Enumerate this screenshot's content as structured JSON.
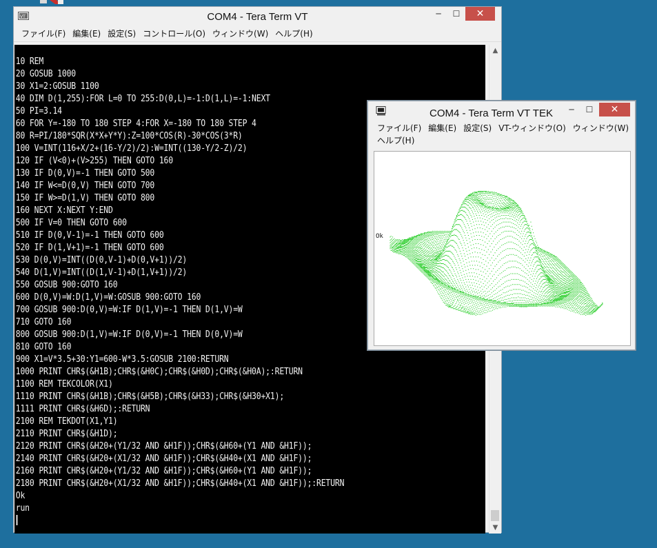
{
  "vt_window": {
    "title": "COM4 - Tera Term VT",
    "menu": [
      {
        "label": "ファイル(F)"
      },
      {
        "label": "編集(E)"
      },
      {
        "label": "設定(S)"
      },
      {
        "label": "コントロール(O)"
      },
      {
        "label": "ウィンドウ(W)"
      },
      {
        "label": "ヘルプ(H)"
      }
    ],
    "terminal_lines": [
      "10 REM",
      "20 GOSUB 1000",
      "30 X1=2:GOSUB 1100",
      "40 DIM D(1,255):FOR L=0 TO 255:D(0,L)=-1:D(1,L)=-1:NEXT",
      "50 PI=3.14",
      "60 FOR Y=-180 TO 180 STEP 4:FOR X=-180 TO 180 STEP 4",
      "80 R=PI/180*SQR(X*X+Y*Y):Z=100*COS(R)-30*COS(3*R)",
      "100 V=INT(116+X/2+(16-Y/2)/2):W=INT((130-Y/2-Z)/2)",
      "120 IF (V<0)+(V>255) THEN GOTO 160",
      "130 IF D(0,V)=-1 THEN GOTO 500",
      "140 IF W<=D(0,V) THEN GOTO 700",
      "150 IF W>=D(1,V) THEN GOTO 800",
      "160 NEXT X:NEXT Y:END",
      "500 IF V=0 THEN GOTO 600",
      "510 IF D(0,V-1)=-1 THEN GOTO 600",
      "520 IF D(1,V+1)=-1 THEN GOTO 600",
      "530 D(0,V)=INT((D(0,V-1)+D(0,V+1))/2)",
      "540 D(1,V)=INT((D(1,V-1)+D(1,V+1))/2)",
      "550 GOSUB 900:GOTO 160",
      "600 D(0,V)=W:D(1,V)=W:GOSUB 900:GOTO 160",
      "700 GOSUB 900:D(0,V)=W:IF D(1,V)=-1 THEN D(1,V)=W",
      "710 GOTO 160",
      "800 GOSUB 900:D(1,V)=W:IF D(0,V)=-1 THEN D(0,V)=W",
      "810 GOTO 160",
      "900 X1=V*3.5+30:Y1=600-W*3.5:GOSUB 2100:RETURN",
      "1000 PRINT CHR$(&H1B);CHR$(&H0C);CHR$(&H0D);CHR$(&H0A);:RETURN",
      "1100 REM TEKCOLOR(X1)",
      "1110 PRINT CHR$(&H1B);CHR$(&H5B);CHR$(&H33);CHR$(&H30+X1);",
      "1111 PRINT CHR$(&H6D);:RETURN",
      "2100 REM TEKDOT(X1,Y1)",
      "2110 PRINT CHR$(&H1D);",
      "2120 PRINT CHR$(&H20+(Y1/32 AND &H1F));CHR$(&H60+(Y1 AND &H1F));",
      "2140 PRINT CHR$(&H20+(X1/32 AND &H1F));CHR$(&H40+(X1 AND &H1F));",
      "2160 PRINT CHR$(&H20+(Y1/32 AND &H1F));CHR$(&H60+(Y1 AND &H1F));",
      "2180 PRINT CHR$(&H20+(X1/32 AND &H1F));CHR$(&H40+(X1 AND &H1F));:RETURN",
      "Ok",
      "run"
    ]
  },
  "tek_window": {
    "title": "COM4 - Tera Term VT TEK",
    "menu": [
      {
        "label": "ファイル(F)"
      },
      {
        "label": "編集(E)"
      },
      {
        "label": "設定(S)"
      },
      {
        "label": "VT-ウィンドウ(O)"
      },
      {
        "label": "ウィンドウ(W)"
      },
      {
        "label": "ヘルプ(H)"
      }
    ],
    "status_text": "Ok",
    "plot_color": "#22cc22"
  },
  "colors": {
    "desktop": "#1e6f9e",
    "terminal_bg": "#000000",
    "terminal_fg": "#f2f2f2",
    "close_button": "#c7504a"
  }
}
